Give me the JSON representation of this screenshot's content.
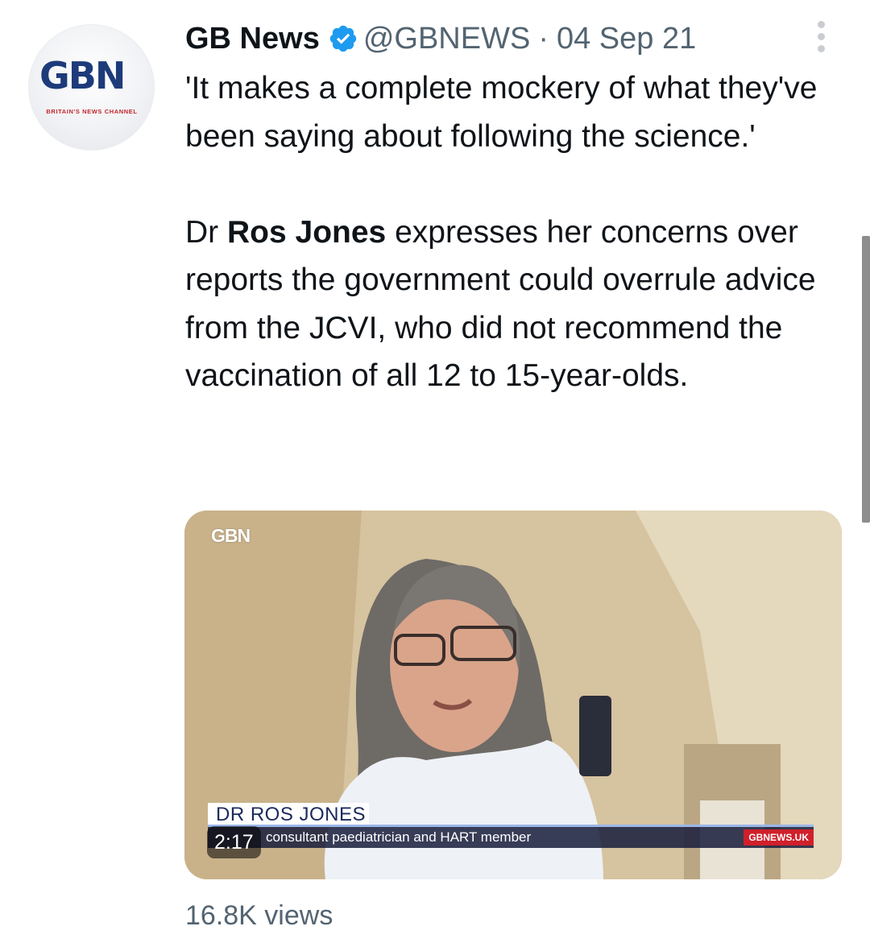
{
  "account": {
    "name": "GB News",
    "handle": "@GBNEWS",
    "separator": "·",
    "date": "04 Sep 21",
    "avatar_logo": "GBN",
    "avatar_tagline": "BRITAIN'S NEWS CHANNEL",
    "verified_icon": "verified-badge-icon",
    "more_icon": "more-options-icon"
  },
  "tweet": {
    "quote": "'It makes a complete mockery of what they've been saying about following the science.'",
    "body_prefix": "Dr ",
    "body_bold": "Ros Jones",
    "body_suffix": " expresses her concerns over reports the government could overrule advice from the JCVI, who did not recommend the vaccination of all 12 to 15-year-olds."
  },
  "media": {
    "watermark": "GBN",
    "lower_third_name": "DR ROS JONES",
    "lower_third_caption": "consultant paediatrician and HART member",
    "lower_third_url": "GBNEWS.UK",
    "duration": "2:17"
  },
  "stats": {
    "views": "16.8K views"
  },
  "colors": {
    "verified": "#1d9bf0",
    "secondary_text": "#536471",
    "brand_red": "#d0202b",
    "brand_blue": "#1d3b7a"
  }
}
